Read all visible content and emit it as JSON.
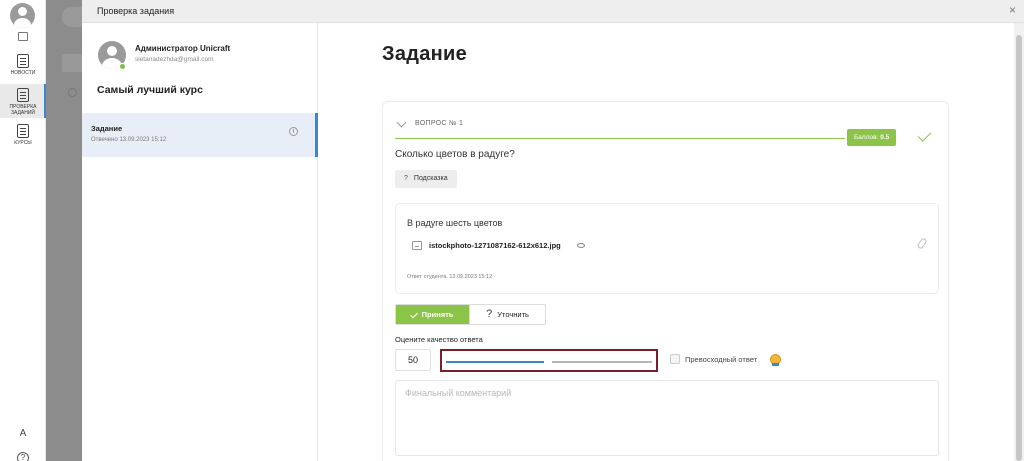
{
  "rail": {
    "items": [
      {
        "label": "Новости"
      },
      {
        "label": "Проверка заданий"
      },
      {
        "label": "Курсы"
      }
    ]
  },
  "modal": {
    "title": "Проверка задания",
    "close": "×"
  },
  "side": {
    "user_name": "Администратор Unicraft",
    "user_email": "sletanadezhda@gmail.com",
    "course_title": "Самый лучший курс",
    "task": {
      "name": "Задание",
      "date": "Отвечено 13.09.2023 15:12"
    }
  },
  "main": {
    "page_title": "Задание",
    "question": {
      "label": "Вопрос № 1",
      "score_label": "Баллов:",
      "score_value": "0.5",
      "text": "Сколько цветов в радуге?",
      "hint_label": "Подсказка"
    },
    "answer": {
      "text": "В радуге шесть цветов",
      "file_name": "istockphoto-1271087162-612x612.jpg",
      "meta": "Ответ студента. 13.09.2023 15:12"
    },
    "actions": {
      "accept_label": "Принять",
      "clarify_label": "Уточнить"
    },
    "rating": {
      "label": "Оцените качество ответа",
      "value": "50",
      "slider_level": 0.5,
      "excellent_label": "Превосходный ответ"
    },
    "comment": {
      "placeholder": "Финальный комментарий"
    }
  },
  "colors": {
    "accent_green": "#8cc44a",
    "accent_blue": "#3a86d1",
    "highlight_border": "#7a1f2b"
  }
}
